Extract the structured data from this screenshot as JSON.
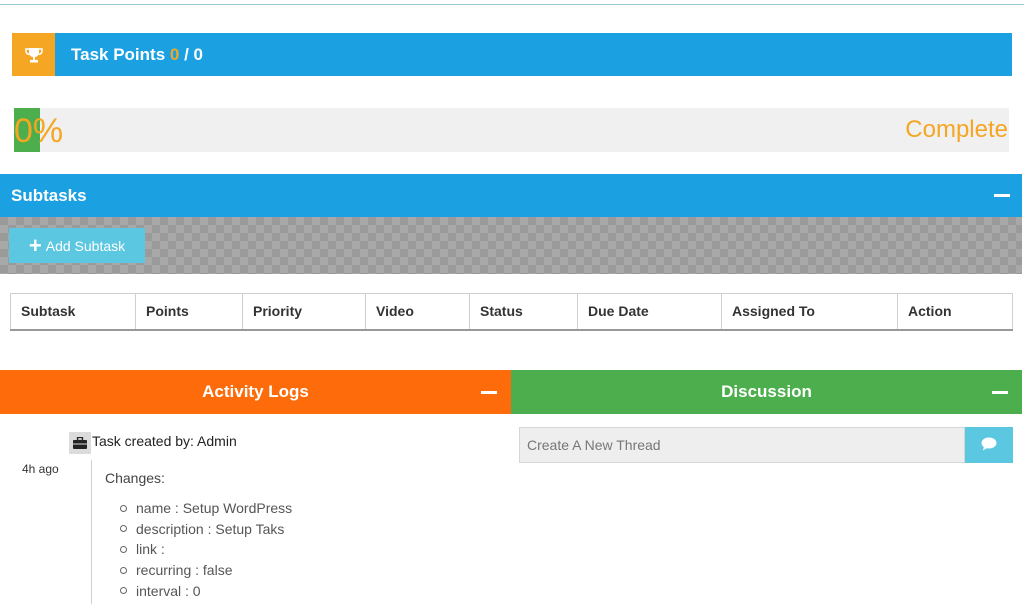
{
  "task_points": {
    "title": "Task Points",
    "current": "0",
    "separator": " / ",
    "total": "0",
    "icon": "trophy-icon"
  },
  "progress": {
    "percent_text": "0%",
    "value": 0,
    "label": "Complete",
    "fill_color": "#4cae4c",
    "text_color": "#f5a623"
  },
  "subtasks": {
    "title": "Subtasks",
    "add_label": "Add Subtask",
    "columns": [
      "Subtask",
      "Points",
      "Priority",
      "Video",
      "Status",
      "Due Date",
      "Assigned To",
      "Action"
    ]
  },
  "activity_logs": {
    "title": "Activity Logs",
    "entries": [
      {
        "icon": "briefcase-icon",
        "title": "Task created by: Admin",
        "time": "4h ago",
        "changes_label": "Changes:",
        "changes": [
          "name : Setup WordPress",
          "description : Setup Taks",
          "link :",
          "recurring : false",
          "interval : 0"
        ]
      }
    ]
  },
  "discussion": {
    "title": "Discussion",
    "input_placeholder": "Create A New Thread",
    "send_icon": "comment-icon"
  },
  "colors": {
    "primary": "#1ba0e2",
    "accent": "#f5a623",
    "activity": "#fd6b0a",
    "discussion": "#4cae4c",
    "button": "#5bc7e0"
  }
}
